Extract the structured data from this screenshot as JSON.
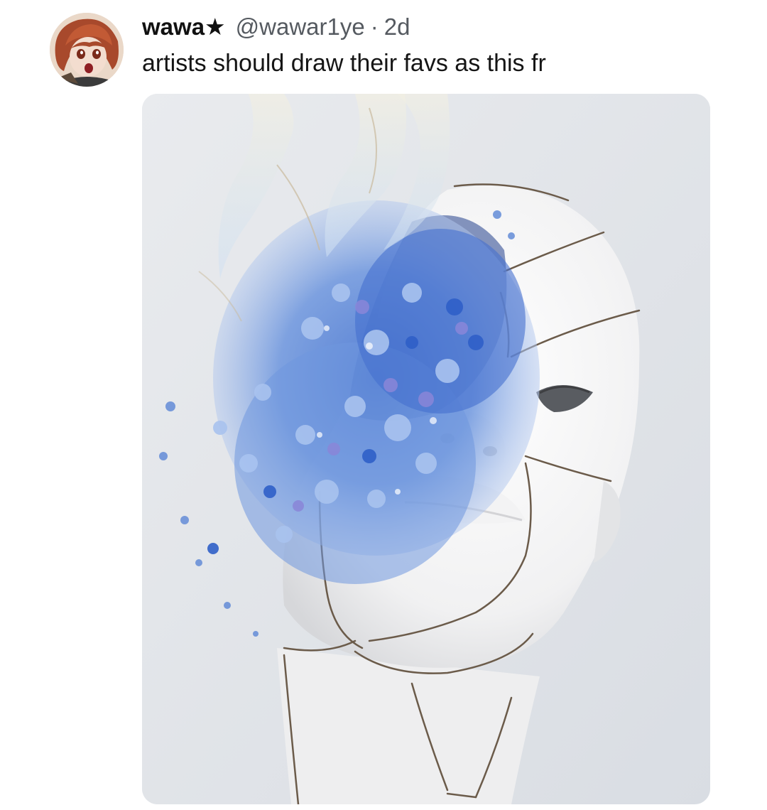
{
  "post": {
    "display_name": "wawa",
    "name_badge": "★",
    "handle": "@wawar1ye",
    "separator": "·",
    "timestamp": "2d",
    "text": "artists should draw their favs as this fr"
  },
  "avatar": {
    "icon": "anime-character-avatar"
  },
  "media": {
    "icon": "sculpture-head-flowers-image",
    "colors": {
      "background": "#e4e7eb",
      "porcelain": "#f7f7f7",
      "flower_blue": "#5b86d6",
      "flower_light": "#a9c3ef",
      "flower_purple": "#8a86d8",
      "crack": "#6b5b4a"
    }
  }
}
